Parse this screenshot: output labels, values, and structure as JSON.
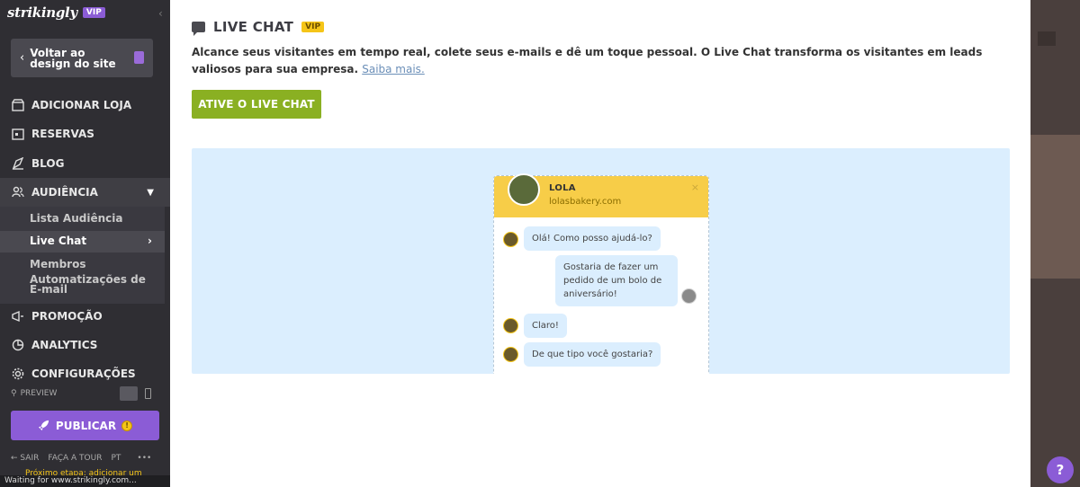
{
  "sidebar": {
    "logo": "strikingly",
    "vip": "VIP",
    "back_label": "Voltar ao design do site",
    "nav": {
      "loja": "ADICIONAR LOJA",
      "reservas": "RESERVAS",
      "blog": "BLOG",
      "audiencia": "AUDIÊNCIA",
      "promocao": "PROMOÇÃO",
      "analytics": "ANALYTICS",
      "config": "CONFIGURAÇÕES"
    },
    "sub": {
      "lista": "Lista Audiência",
      "livechat": "Live Chat",
      "membros": "Membros",
      "automacoes": "Automatizações de E-mail"
    },
    "preview_label": "PREVIEW",
    "publish_label": "PUBLICAR",
    "footer": {
      "sair": "← SAIR",
      "tour": "FAÇA A TOUR",
      "lang": "PT",
      "more": "•••",
      "next": "Próximo etapa: adicionar um"
    }
  },
  "statusbar": "Waiting for www.strikingly.com...",
  "main": {
    "title": "LIVE CHAT",
    "vip": "VIP",
    "description": "Alcance seus visitantes em tempo real, colete seus e-mails e dê um toque pessoal. O Live Chat transforma os visitantes em leads valiosos para sua empresa.",
    "learn_more": "Saiba mais.",
    "cta": "ATIVE O LIVE CHAT"
  },
  "widget": {
    "name": "LOLA",
    "site": "lolasbakery.com",
    "close": "×",
    "messages": {
      "m1": "Olá! Como posso ajudá-lo?",
      "m2": "Gostaria de fazer um pedido de um bolo de aniversário!",
      "m3": "Claro!",
      "m4": "De que tipo você gostaria?"
    }
  },
  "help": "?"
}
